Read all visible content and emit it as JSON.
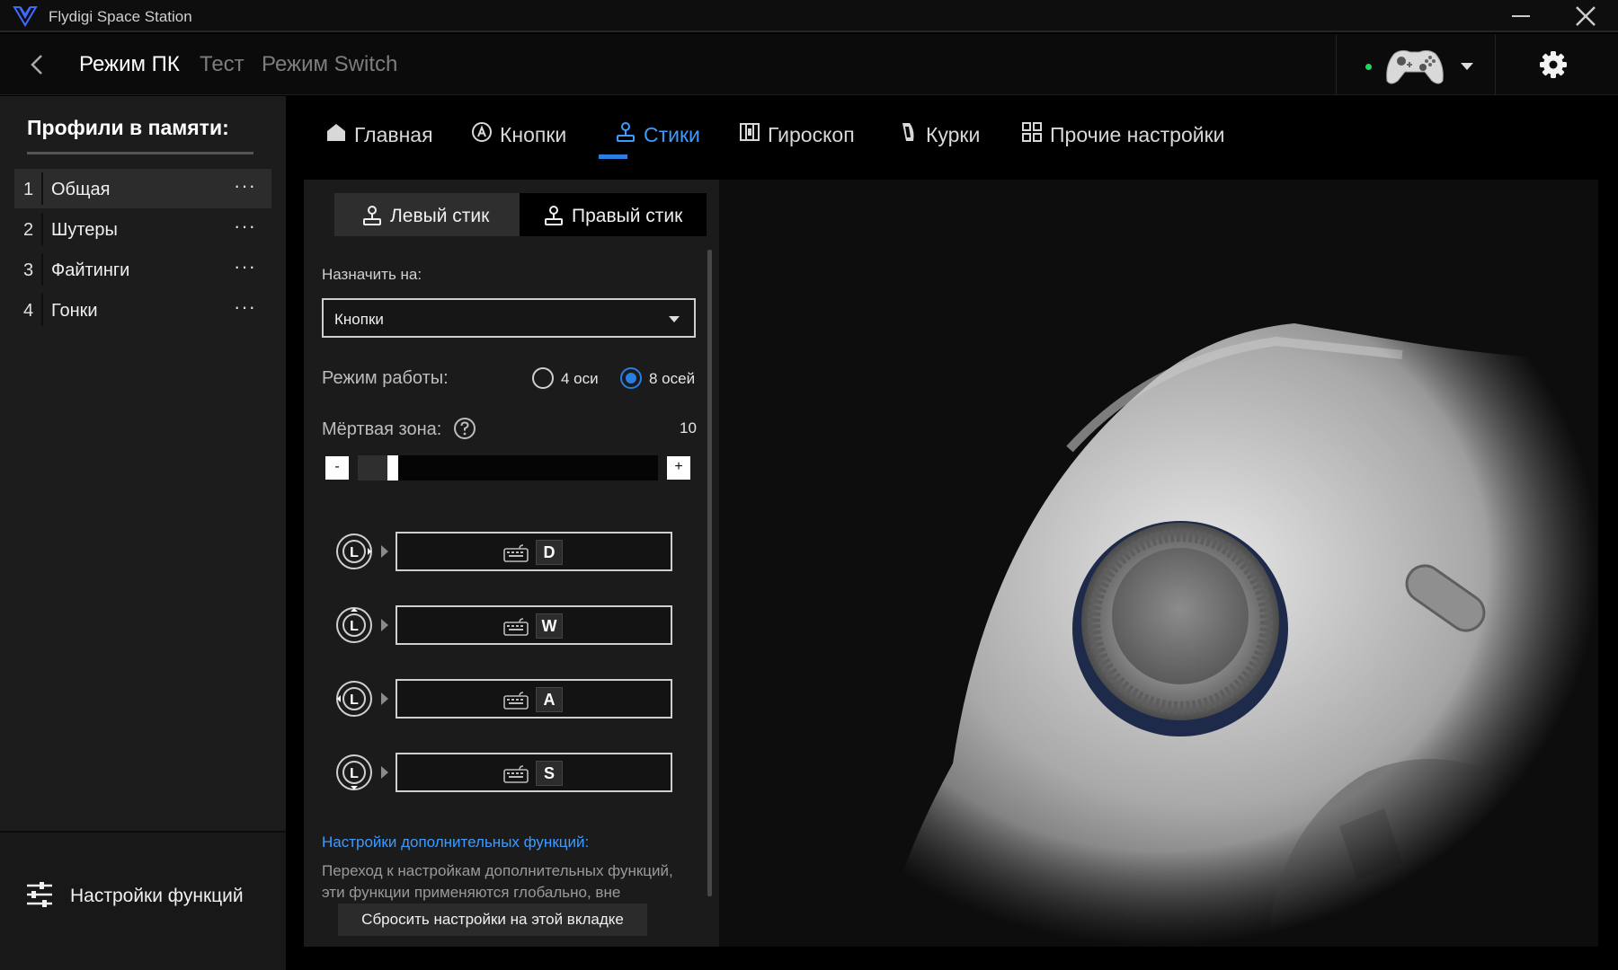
{
  "window": {
    "title": "Flydigi Space Station"
  },
  "header": {
    "tabs": [
      {
        "label": "Режим ПК",
        "active": true
      },
      {
        "label": "Тест",
        "active": false
      },
      {
        "label": "Режим Switch",
        "active": false
      }
    ],
    "device_status_color": "#1ed760"
  },
  "sidebar": {
    "title": "Профили в памяти:",
    "profiles": [
      {
        "num": "1",
        "name": "Общая",
        "more": "···",
        "active": true
      },
      {
        "num": "2",
        "name": "Шутеры",
        "more": "···",
        "active": false
      },
      {
        "num": "3",
        "name": "Файтинги",
        "more": "···",
        "active": false
      },
      {
        "num": "4",
        "name": "Гонки",
        "more": "···",
        "active": false
      }
    ],
    "func_settings_label": "Настройки функций"
  },
  "main_tabs": [
    {
      "label": "Главная",
      "icon": "home-icon"
    },
    {
      "label": "Кнопки",
      "icon": "button-a-icon"
    },
    {
      "label": "Стики",
      "icon": "joystick-icon",
      "active": true
    },
    {
      "label": "Гироскоп",
      "icon": "gyroscope-icon"
    },
    {
      "label": "Курки",
      "icon": "trigger-icon"
    },
    {
      "label": "Прочие настройки",
      "icon": "grid-icon"
    }
  ],
  "stick_tabs": {
    "left": "Левый стик",
    "right": "Правый стик",
    "active": "left"
  },
  "settings": {
    "assign_label": "Назначить на:",
    "assign_value": "Кнопки",
    "mode_label": "Режим работы:",
    "mode_options": [
      "4 оси",
      "8 осей"
    ],
    "mode_selected": "8 осей",
    "deadzone_label": "Мёртвая зона:",
    "deadzone_value": "10",
    "deadzone_level_percent": 10,
    "minus": "-",
    "plus": "+"
  },
  "directions": [
    {
      "dir": "right",
      "stick": "L",
      "key": "D"
    },
    {
      "dir": "up",
      "stick": "L",
      "key": "W"
    },
    {
      "dir": "left",
      "stick": "L",
      "key": "A"
    },
    {
      "dir": "down",
      "stick": "L",
      "key": "S"
    }
  ],
  "advanced": {
    "link": "Настройки дополнительных функций:",
    "desc": "Переход к настройкам дополнительных функций, эти функции применяются глобально, вне"
  },
  "reset_label": "Сбросить настройки на этой вкладке",
  "colors": {
    "accent": "#2a7de1",
    "link": "#3d9bff"
  }
}
